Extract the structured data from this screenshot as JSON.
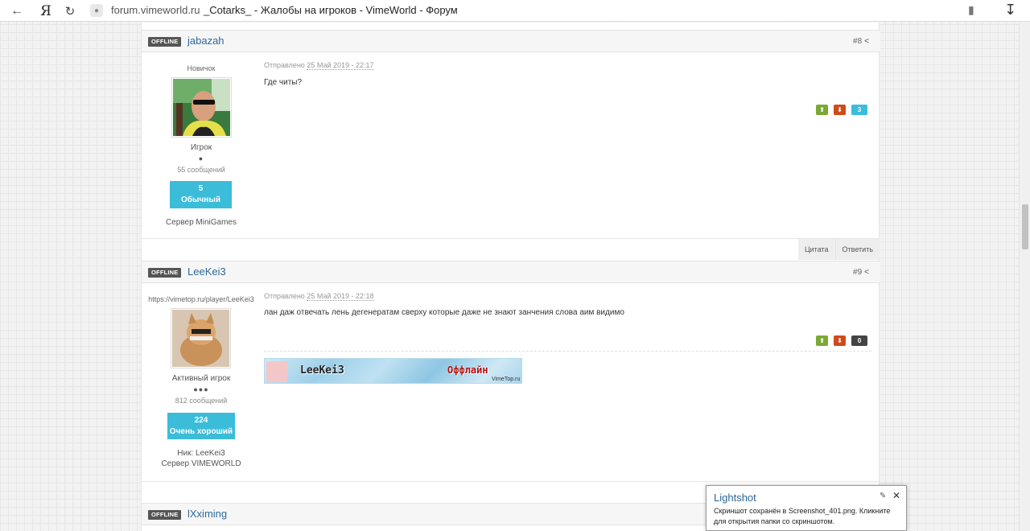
{
  "browser": {
    "url": "forum.vimeworld.ru",
    "title": "_Cotarks_ - Жалобы на игроков - VimeWorld - Форум",
    "ya_label": "Я"
  },
  "posts": [
    {
      "status": "OFFLINE",
      "username": "jabazah",
      "number": "#8",
      "rank": "Новичок",
      "group": "Игрок",
      "pips": "●",
      "messages": "55 сообщений",
      "rep_value": "5",
      "rep_label": "Обычный",
      "custom_field": "",
      "server": "Сервер MiniGames",
      "posted_label": "Отправлено",
      "date": "25 Май 2019 - 22:17",
      "text": "Где читы?",
      "score": "3",
      "score_color": "#3bbcd9",
      "actions": [
        "Цитата",
        "Ответить"
      ]
    },
    {
      "status": "OFFLINE",
      "username": "LeeKei3",
      "number": "#9",
      "rank": "https://vimetop.ru/player/LeeKei3",
      "group": "Активный игрок",
      "pips": "●●●",
      "messages": "812 сообщений",
      "rep_value": "224",
      "rep_label": "Очень хороший",
      "custom_field": "Ник: LeeKei3",
      "server": "Сервер VIMEWORLD",
      "posted_label": "Отправлено",
      "date": "25 Май 2019 - 22:18",
      "text": "лан даж отвечать лень дегенератам сверху которые даже не знают занчения слова аим видимо",
      "score": "0",
      "score_color": "#444444",
      "signature": {
        "nick": "LeeKei3",
        "status": "Оффлайн",
        "site": "VimeTop.ru"
      }
    },
    {
      "status": "OFFLINE",
      "username": "lXximing"
    }
  ],
  "toast": {
    "title": "Lightshot",
    "text": "Скриншот сохранён в Screenshot_401.png. Кликните для открытия папки со скриншотом."
  },
  "icons": {
    "up": "up-arrow-icon",
    "down": "down-arrow-icon",
    "share": "share-icon",
    "close": "close-icon"
  }
}
